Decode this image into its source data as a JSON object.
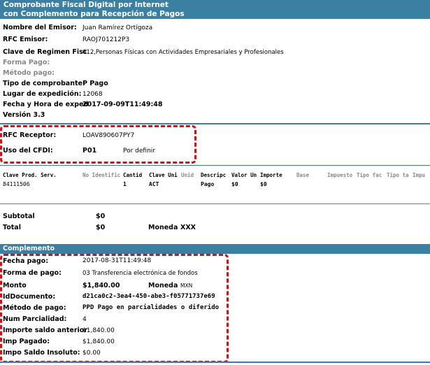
{
  "header": {
    "title_line1": "Comprobante Fiscal Digital por Internet",
    "title_line2": "con Complemento para Recepción de Pagos"
  },
  "emisor": {
    "nombre_label": "Nombre del Emisor:",
    "nombre_value": "Juan Ramírez Ortígoza",
    "rfc_label": "RFC Emisor:",
    "rfc_value": "RAOJ701212P3",
    "regimen_label": "Clave de Regimen Fisc",
    "regimen_value": "612,Personas Físicas con Actividades Empresariales y Profesionales",
    "forma_label": "Forma Pago:",
    "metodo_label": "Método pago:",
    "tipo_label": "Tipo de comprobante:",
    "tipo_value": "P  Pago",
    "lugar_label": "Lugar de expedición:",
    "lugar_value": "12068",
    "fecha_label": "Fecha y Hora de exped",
    "fecha_value": "2017-09-09T11:49:48",
    "version": "Versión 3.3"
  },
  "receptor": {
    "rfc_label": "RFC Receptor:",
    "rfc_value": "LOAV890607PY7",
    "uso_label": "Uso del CFDI:",
    "uso_code": "P01",
    "uso_desc": "Por definir"
  },
  "conceptos": {
    "headers": [
      "Clave Prod. Serv.",
      "No Identific",
      "Cantid",
      "Clave Uni",
      "Unid",
      "Descripc",
      "Valor Un",
      "Importe",
      "Base",
      "Impuesto",
      "Tipo fac",
      "Tipo ta",
      "Impu"
    ],
    "row": [
      "84111506",
      "1",
      "ACT",
      "Pago",
      "$0",
      "$0"
    ]
  },
  "totales": {
    "subtotal_label": "Subtotal",
    "subtotal_value": "$0",
    "total_label": "Total",
    "total_value": "$0",
    "moneda_label": "Moneda",
    "moneda_value": "XXX"
  },
  "complemento": {
    "title": "Complemento",
    "fecha_label": "Fecha pago:",
    "fecha_value": "2017-08-31T11:49:48",
    "forma_label": "Forma de pago:",
    "forma_value": "03 Transferencia electrónica de fondos",
    "monto_label": "Monto",
    "monto_value": "$1,840.00",
    "moneda_label": "Moneda",
    "moneda_value": "MXN",
    "iddoc_label": "IdDocumento:",
    "iddoc_value": "d21ca0c2-3ea4-450-abe3-f05771737e69",
    "metodo_label": "Método de pago:",
    "metodo_value": "PPD Pago en parcialidades o diferido",
    "parcialidad_label": "Num Parcialidad:",
    "parcialidad_value": "4",
    "saldo_ant_label": "Importe saldo anterior",
    "saldo_ant_value": "$1,840.00",
    "pagado_label": "Imp Pagado:",
    "pagado_value": "$1,840.00",
    "insoluto_label": "Impo Saldo Insoluto:",
    "insoluto_value": "$0.00"
  },
  "colors": {
    "header_bg": "#3b7fa3",
    "highlight": "#c4161c"
  }
}
